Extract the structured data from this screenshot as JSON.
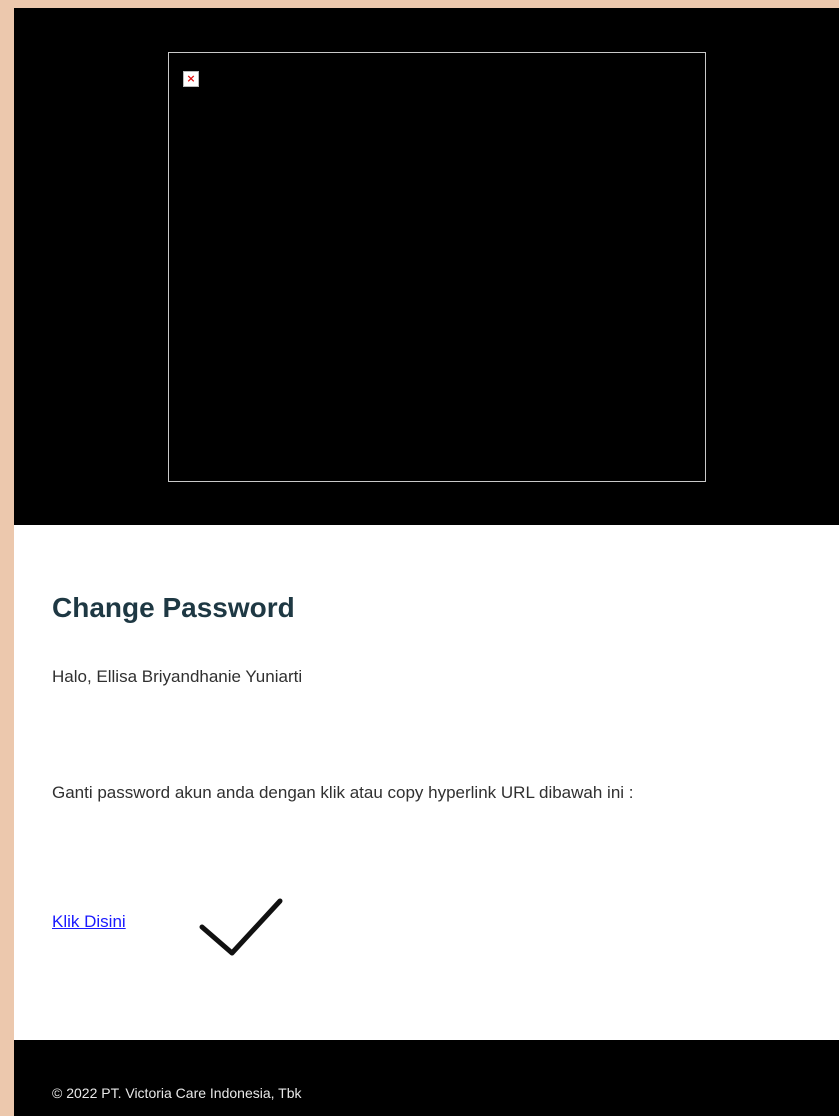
{
  "header": {
    "image_icon": "broken-image-icon",
    "icon_glyph": "×"
  },
  "content": {
    "title": "Change Password",
    "greeting": "Halo, Ellisa Briyandhanie Yuniarti",
    "instruction": "Ganti password akun anda dengan klik atau copy hyperlink URL dibawah ini :",
    "link_label": "Klik Disini",
    "annotation_icon": "checkmark-icon"
  },
  "footer": {
    "copyright": "© 2022 PT. Victoria Care Indonesia, Tbk"
  },
  "colors": {
    "page_background": "#ecc8ad",
    "header_background": "#000000",
    "title": "#1e3843",
    "link": "#1a1aff",
    "footer_background": "#000000"
  }
}
